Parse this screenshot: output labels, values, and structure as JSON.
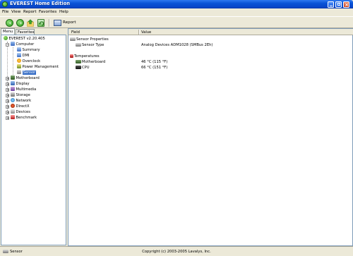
{
  "window": {
    "title": "EVEREST Home Edition"
  },
  "menubar": {
    "items": [
      "File",
      "View",
      "Report",
      "Favorites",
      "Help"
    ]
  },
  "toolbar": {
    "report_label": "Report"
  },
  "left_pane": {
    "tabs": [
      "Menu",
      "Favorites"
    ],
    "tree": {
      "root": "EVEREST v2.20.405",
      "computer": "Computer",
      "computer_children": [
        "Summary",
        "DMI",
        "Overclock",
        "Power Management",
        "Sensor"
      ],
      "selected": "Sensor",
      "other": [
        "Motherboard",
        "Display",
        "Multimedia",
        "Storage",
        "Network",
        "DirectX",
        "Devices",
        "Benchmark"
      ]
    }
  },
  "right_pane": {
    "columns": [
      "Field",
      "Value"
    ],
    "groups": [
      {
        "title": "Sensor Properties",
        "icon": "sensor-icon",
        "rows": [
          {
            "field": "Sensor Type",
            "value": "Analog Devices ADM1028  (SMBus 2Eh)",
            "icon": "sensor-icon"
          }
        ]
      },
      {
        "title": "Temperatures",
        "icon": "thermometer-icon",
        "rows": [
          {
            "field": "Motherboard",
            "value": "46 °C  (115 °F)",
            "icon": "motherboard-icon"
          },
          {
            "field": "CPU",
            "value": "66 °C  (151 °F)",
            "icon": "cpu-icon"
          }
        ]
      }
    ]
  },
  "statusbar": {
    "left": "Sensor",
    "center": "Copyright (c) 2003-2005 Lavalys, Inc."
  }
}
